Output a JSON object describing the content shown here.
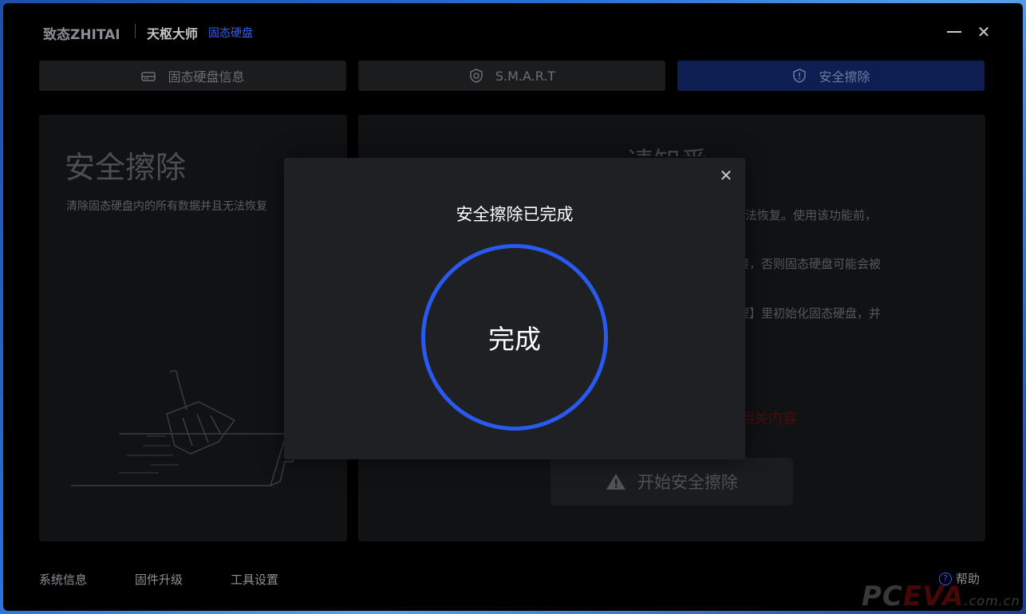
{
  "app": {
    "brand": "致态ZHITAI",
    "product": "天枢大师",
    "product_sub": "固态硬盘",
    "minimize_icon": "minimize-icon",
    "close_icon": "close-icon"
  },
  "tabs": [
    {
      "label": "固态硬盘信息",
      "icon": "drive-icon"
    },
    {
      "label": "S.M.A.R.T",
      "icon": "shield-icon"
    },
    {
      "label": "安全擦除",
      "icon": "shield-alert-icon",
      "active": true
    }
  ],
  "left_panel": {
    "title": "安全擦除",
    "description": "清除固态硬盘内的所有数据并且无法恢复"
  },
  "right_panel": {
    "title": "请知悉",
    "lines": [
      "无法恢复。使用该功能前，",
      "接，否则固态硬盘可能会被",
      "理】里初始化固态硬盘，并"
    ],
    "red_text": "相关内容",
    "start_button": "开始安全擦除"
  },
  "dialog": {
    "title": "安全擦除已完成",
    "status": "完成",
    "progress": 1.0
  },
  "footer": {
    "system_info": "系统信息",
    "firmware_upgrade": "固件升级",
    "tool_settings": "工具设置",
    "help": "帮助"
  },
  "watermark": {
    "pc": "PC",
    "eva": "EVA",
    "com": ".com.cn"
  },
  "colors": {
    "accent": "#2a59f0",
    "active_tab": "#0e1d52",
    "dialog_bg": "#1f2024",
    "warning_red": "#4a0d0d"
  }
}
